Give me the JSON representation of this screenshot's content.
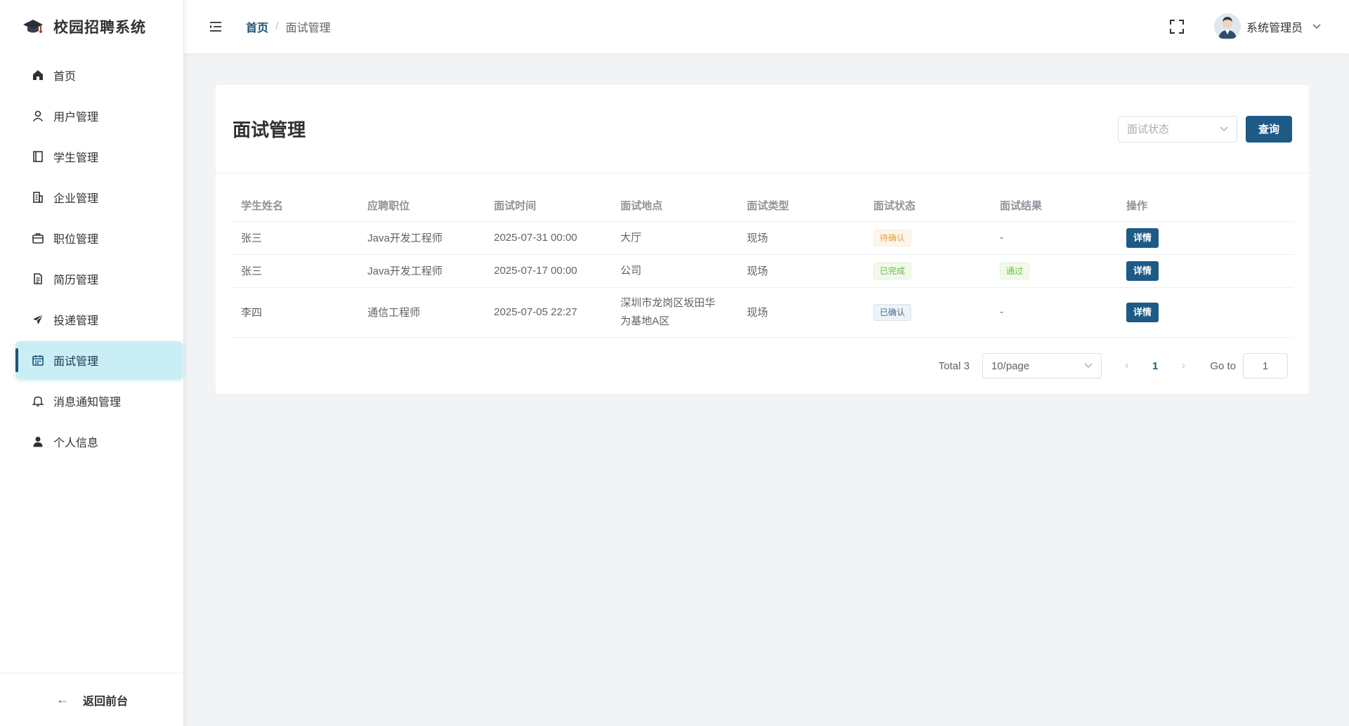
{
  "app": {
    "title": "校园招聘系统"
  },
  "sidebar": {
    "items": [
      {
        "label": "首页",
        "icon": "home-icon"
      },
      {
        "label": "用户管理",
        "icon": "user-icon"
      },
      {
        "label": "学生管理",
        "icon": "book-icon"
      },
      {
        "label": "企业管理",
        "icon": "building-icon"
      },
      {
        "label": "职位管理",
        "icon": "briefcase-icon"
      },
      {
        "label": "简历管理",
        "icon": "document-icon"
      },
      {
        "label": "投递管理",
        "icon": "send-icon"
      },
      {
        "label": "面试管理",
        "icon": "calendar-icon",
        "active": true
      },
      {
        "label": "消息通知管理",
        "icon": "bell-icon"
      },
      {
        "label": "个人信息",
        "icon": "person-icon"
      }
    ],
    "back_label": "返回前台"
  },
  "header": {
    "breadcrumb": {
      "home": "首页",
      "separator": "/",
      "current": "面试管理"
    },
    "user_name": "系统管理员"
  },
  "main": {
    "title": "面试管理",
    "filter": {
      "status_placeholder": "面试状态",
      "query_label": "查询"
    },
    "table": {
      "columns": [
        "学生姓名",
        "应聘职位",
        "面试时间",
        "面试地点",
        "面试类型",
        "面试状态",
        "面试结果",
        "操作"
      ],
      "rows": [
        {
          "student": "张三",
          "position": "Java开发工程师",
          "time": "2025-07-31 00:00",
          "location_line1": "大厅",
          "location_line2": "",
          "type": "现场",
          "status": "待确认",
          "result": "-",
          "action": "详情"
        },
        {
          "student": "张三",
          "position": "Java开发工程师",
          "time": "2025-07-17 00:00",
          "location_line1": "公司",
          "location_line2": "",
          "type": "现场",
          "status": "已完成",
          "result": "通过",
          "action": "详情"
        },
        {
          "student": "李四",
          "position": "通信工程师",
          "time": "2025-07-05 22:27",
          "location_line1": "深圳市龙岗区坂田华",
          "location_line2": "为基地A区",
          "type": "现场",
          "status": "已确认",
          "result": "-",
          "action": "详情"
        }
      ]
    },
    "pagination": {
      "total": "Total 3",
      "page_size": "10/page",
      "current_page": "1",
      "goto_label": "Go to",
      "goto_value": "1"
    }
  },
  "colors": {
    "primary": "#1d5a86",
    "active_menu_bg": "#c9eef6",
    "warning": "#e6a23c",
    "success": "#67c23a"
  }
}
